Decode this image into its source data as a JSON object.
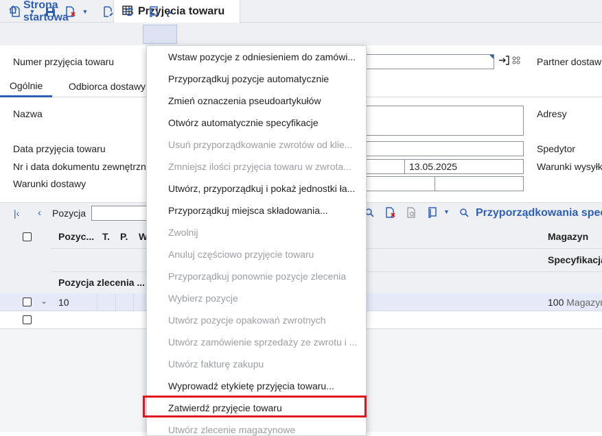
{
  "tabs": {
    "home": "Strona startowa",
    "goods": "Przyjęcia towaru"
  },
  "form": {
    "number_label": "Numer przyjęcia towaru",
    "partner_label": "Partner dostaw",
    "name_label": "Nazwa",
    "addresses_label": "Adresy",
    "date_label": "Data przyjęcia towaru",
    "carrier_label": "Spedytor",
    "extdoc_label": "Nr i data dokumentu zewnętrzn",
    "extdoc_date": "13.05.2025",
    "shipping_label": "Warunki wysyłk",
    "delivery_label": "Warunki dostawy"
  },
  "subtabs": {
    "general": "Ogólnie",
    "recipient": "Odbiorca dostawy"
  },
  "table": {
    "position_label": "Pozycja",
    "assignments": "Przyporządkowania spec",
    "col_position": "Pozyc...",
    "col_t": "T.",
    "col_p": "P.",
    "col_w": "W",
    "col_warehouse": "Magazyn",
    "col_spec": "Specyfikacja",
    "col_order_position": "Pozycja zlecenia ...",
    "row1_position": "10",
    "row1_warehouse_num": "100",
    "row1_warehouse_text": "Magazyn"
  },
  "menu": [
    {
      "label": "Wstaw pozycje z odniesieniem do zamówi...",
      "enabled": true
    },
    {
      "label": "Przyporządkuj pozycje automatycznie",
      "enabled": true
    },
    {
      "label": "Zmień oznaczenia pseudoartykułów",
      "enabled": true
    },
    {
      "label": "Otwórz automatycznie specyfikacje",
      "enabled": true
    },
    {
      "label": "Usuń przyporządkowanie zwrotów od klie...",
      "enabled": false
    },
    {
      "label": "Zmniejsz ilości przyjęcia towaru w zwrota...",
      "enabled": false
    },
    {
      "label": "Utwórz, przyporządkuj i pokaż jednostki ła...",
      "enabled": true
    },
    {
      "label": "Przyporządkuj miejsca składowania...",
      "enabled": true
    },
    {
      "label": "Zwolnij",
      "enabled": false
    },
    {
      "label": "Anuluj częściowo przyjęcie towaru",
      "enabled": false
    },
    {
      "label": "Przyporządkuj ponownie pozycje zlecenia",
      "enabled": false
    },
    {
      "label": "Wybierz pozycje",
      "enabled": false
    },
    {
      "label": "Utwórz pozycje opakowań zwrotnych",
      "enabled": false
    },
    {
      "label": "Utwórz zamówienie sprzedaży ze zwrotu i ...",
      "enabled": false
    },
    {
      "label": "Utwórz fakturę zakupu",
      "enabled": false
    },
    {
      "label": "Wyprowadź etykietę przyjęcia towaru...",
      "enabled": true
    },
    {
      "label": "Zatwierdź przyjęcie towaru",
      "enabled": true
    },
    {
      "label": "Utwórz zlecenie magazynowe",
      "enabled": false
    }
  ],
  "colors": {
    "accent": "#2f5fb3",
    "highlight": "#e0141e",
    "toolbar_bg": "#eef0f3"
  }
}
